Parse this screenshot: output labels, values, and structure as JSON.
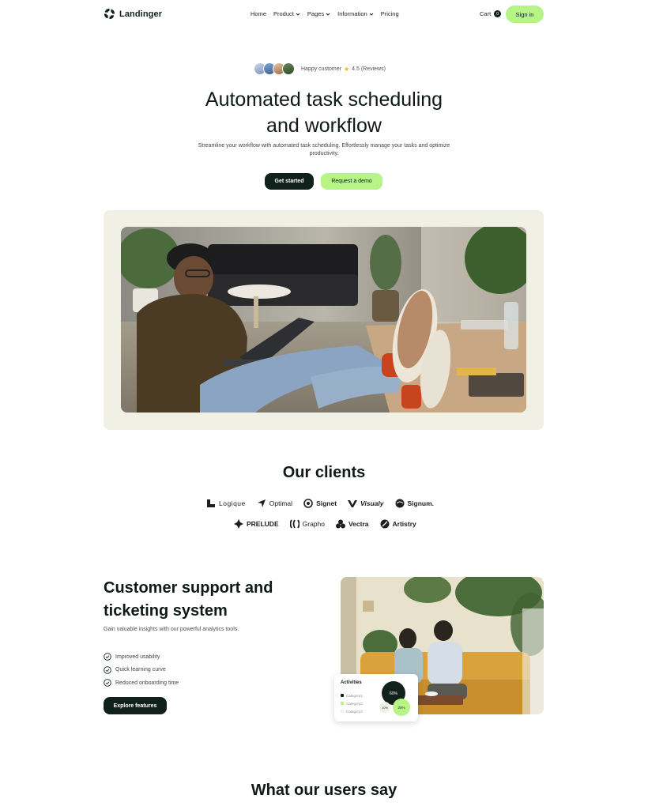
{
  "nav": {
    "brand": "Landinger",
    "menu": [
      {
        "label": "Home",
        "dropdown": false
      },
      {
        "label": "Product",
        "dropdown": true
      },
      {
        "label": "Pages",
        "dropdown": true
      },
      {
        "label": "Information",
        "dropdown": true
      },
      {
        "label": "Pricing",
        "dropdown": false
      }
    ],
    "cart_label": "Cart",
    "cart_count": "0",
    "signin_label": "Sign in"
  },
  "hero": {
    "social_label": "Happy customer",
    "rating": "4.5 (Reviews)",
    "title_line1": "Automated task scheduling",
    "title_line2": "and workflow",
    "subtitle": "Streamline your workflow with automated task scheduling. Effortlessly manage your tasks and optimize productivity.",
    "primary_cta": "Get started",
    "secondary_cta": "Request a demo"
  },
  "clients": {
    "title": "Our clients",
    "row1": [
      "Logique",
      "Optimal",
      "Signet",
      "Visualy",
      "Signum."
    ],
    "row2": [
      "PRELUDE",
      "Grapho",
      "Vectra",
      "Artistry"
    ]
  },
  "feature": {
    "title": "Customer support and ticketing system",
    "subtitle": "Gain valuable insights with our powerful analytics tools.",
    "checks": [
      "Improved usability",
      "Quick learning curve",
      "Reduced onboarding time"
    ],
    "cta": "Explore features",
    "activities": {
      "title": "Activities",
      "categories": [
        "Category1",
        "Category2",
        "Category3"
      ],
      "bubbles": [
        "60%",
        "10%",
        "20%"
      ]
    }
  },
  "testimonials": {
    "title": "What our users say"
  },
  "colors": {
    "accent": "#b6f486",
    "dark": "#10201a",
    "frame": "#f0f1e4"
  }
}
